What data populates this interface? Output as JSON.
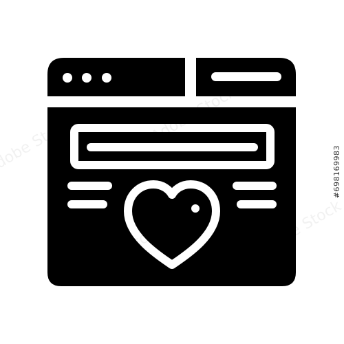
{
  "icon": {
    "name": "webpage-heart-icon",
    "fill_color": "#000000",
    "detail_color": "#ffffff",
    "background_color": "#ffffff"
  },
  "watermark": {
    "text": "Adobe Stock",
    "id_label": "#698169983",
    "color": "#000000"
  }
}
